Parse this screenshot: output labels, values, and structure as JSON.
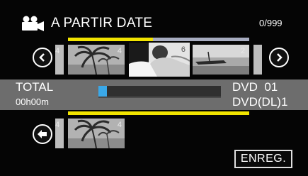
{
  "header": {
    "icon": "video-camera-icon",
    "title": "A PARTIR DATE",
    "counter": "0/999"
  },
  "top_progress": {
    "fill_fraction": 0.47
  },
  "thumbnail_strip": {
    "left_partial_number": "4",
    "items": [
      {
        "number": "4",
        "icon": "palm-tree-thumbnail"
      },
      {
        "number": "6",
        "icon": "person-thumbnail",
        "selected": true
      },
      {
        "number": "2",
        "icon": "boat-thumbnail"
      }
    ]
  },
  "status": {
    "total_label": "TOTAL",
    "total_time": "00h00m",
    "capacity_fraction": 0.07,
    "disc_line1": "DVD  01",
    "disc_line2": "DVD(DL)1"
  },
  "selected_strip": {
    "left_partial_number": "4",
    "items": [
      {
        "number": "4",
        "icon": "palm-tree-thumbnail"
      }
    ]
  },
  "buttons": {
    "register_label": "ENREG."
  },
  "colors": {
    "accent_yellow": "#f2e400",
    "capacity_blue": "#3aa8e8",
    "band_gray": "#6d6d6d"
  }
}
